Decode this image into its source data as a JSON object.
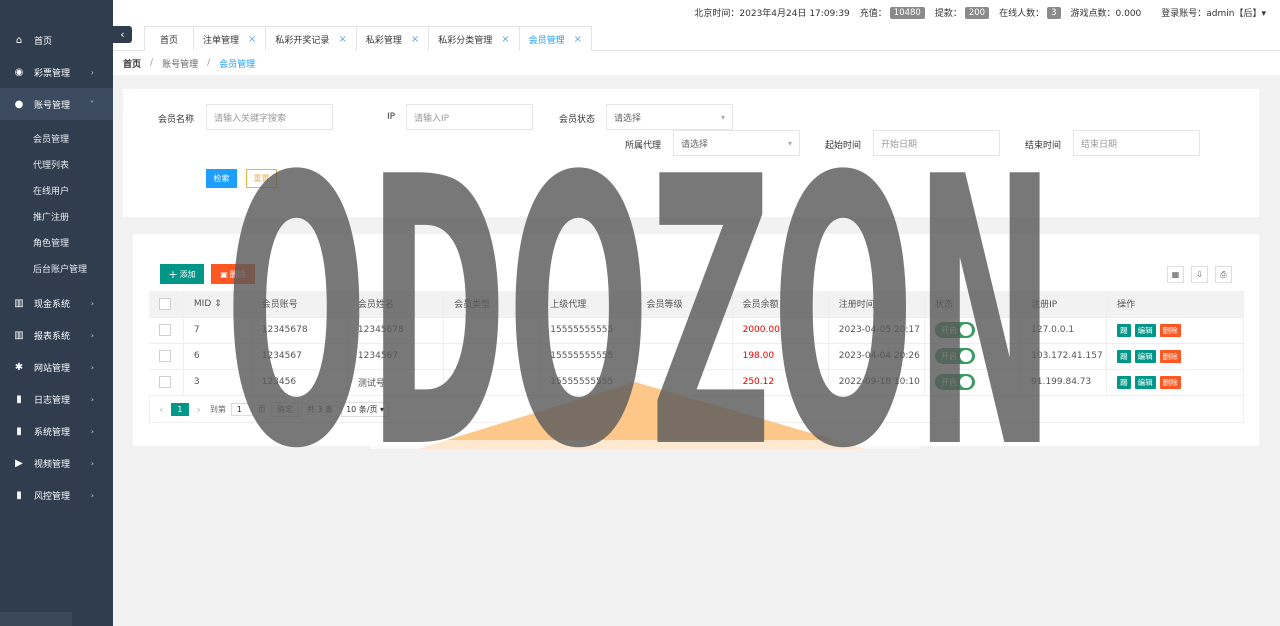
{
  "sidebar": {
    "items": [
      {
        "icon": "home-icon",
        "glyph": "⌂",
        "label": "首页"
      },
      {
        "icon": "gamepad-icon",
        "glyph": "◉",
        "label": "彩票管理",
        "arrow": "›"
      },
      {
        "icon": "user-icon",
        "glyph": "●",
        "label": "账号管理",
        "arrow": "˅"
      },
      {
        "icon": "bank-icon",
        "glyph": "▥",
        "label": "现金系统",
        "arrow": "›"
      },
      {
        "icon": "bank-icon",
        "glyph": "▥",
        "label": "报表系统",
        "arrow": "›"
      },
      {
        "icon": "gear-icon",
        "glyph": "✱",
        "label": "网站管理",
        "arrow": "›"
      },
      {
        "icon": "bar-chart-icon",
        "glyph": "▮",
        "label": "日志管理",
        "arrow": "›"
      },
      {
        "icon": "bar-chart-icon",
        "glyph": "▮",
        "label": "系统管理",
        "arrow": "›"
      },
      {
        "icon": "video-icon",
        "glyph": "▶",
        "label": "视频管理",
        "arrow": "›"
      },
      {
        "icon": "bar-chart-icon",
        "glyph": "▮",
        "label": "风控管理",
        "arrow": "›"
      }
    ],
    "subitems": [
      "会员管理",
      "代理列表",
      "在线用户",
      "推广注册",
      "角色管理",
      "后台账户管理"
    ]
  },
  "topbar": {
    "time": "北京时间：2023年4月24日 17:09:39",
    "recharge_label": "充值：",
    "recharge_count": "10480",
    "withdraw_label": "提款：",
    "withdraw_count": "200",
    "online_label": "在线人数：",
    "online_count": "3",
    "game_points": "游戏点数：0.000",
    "account": "登录账号：admin【后】▾"
  },
  "collapse_glyph": "‹",
  "tabs": [
    {
      "label": "首页",
      "closable": false
    },
    {
      "label": "注单管理",
      "closable": true
    },
    {
      "label": "私彩开奖记录",
      "closable": true
    },
    {
      "label": "私彩管理",
      "closable": true
    },
    {
      "label": "私彩分类管理",
      "closable": true
    },
    {
      "label": "会员管理",
      "closable": true,
      "active": true
    }
  ],
  "tab_close_glyph": "×",
  "breadcrumb": {
    "home": "首页",
    "sep": "/",
    "parent": "账号管理",
    "current": "会员管理"
  },
  "search": {
    "name_label": "会员名称",
    "name_placeholder": "请输入关键字搜索",
    "ip_label": "IP",
    "ip_placeholder": "请输入IP",
    "status_label": "会员状态",
    "status_value": "请选择",
    "agent_label": "所属代理",
    "agent_value": "请选择",
    "start_label": "起始时间",
    "start_placeholder": "开始日期",
    "end_label": "结束时间",
    "end_placeholder": "结束日期",
    "search_btn": "检索",
    "reset_btn": "重置",
    "dropdown_glyph": "▾"
  },
  "toolbar": {
    "add": "添加",
    "delete": "删除",
    "icons": [
      "columns-icon",
      "export-icon",
      "print-icon"
    ]
  },
  "table": {
    "headers": [
      "MID ⇕",
      "会员账号",
      "会员姓名",
      "会员类型",
      "上级代理",
      "会员等级",
      "会员余额",
      "注册时间",
      "状态",
      "注册IP",
      "操作"
    ],
    "rows": [
      {
        "mid": "7",
        "account": "12345678",
        "name": "12345678",
        "type": "",
        "agent": "15555555555",
        "level": "",
        "balance": "2000.00",
        "reg": "2023-04-05 20:17",
        "status": "开启",
        "ip": "127.0.0.1"
      },
      {
        "mid": "6",
        "account": "1234567",
        "name": "1234567",
        "type": "",
        "agent": "15555555555",
        "level": "",
        "balance": "198.00",
        "reg": "2023-04-04 20:26",
        "status": "开启",
        "ip": "103.172.41.157"
      },
      {
        "mid": "3",
        "account": "123456",
        "name": "测试号",
        "type": "",
        "agent": "15555555555",
        "level": "",
        "balance": "250.12",
        "reg": "2022-09-18 10:10",
        "status": "开启",
        "ip": "91.199.84.73"
      }
    ],
    "ops": [
      "踢",
      "编辑",
      "删除"
    ]
  },
  "pagination": {
    "prev": "‹",
    "page": "1",
    "next": "›",
    "goto": "到第",
    "page_input": "1",
    "page_unit": "页",
    "confirm": "确定",
    "total": "共 3 条",
    "per_page": "10 条/页 ▾"
  },
  "watermark": {
    "text": "ODOZON"
  },
  "colors": {
    "sidebar": "#2f3d4f",
    "accent": "#1e9fff",
    "green": "#009688",
    "red": "#ff5722",
    "badge": "#8a8a8a"
  }
}
